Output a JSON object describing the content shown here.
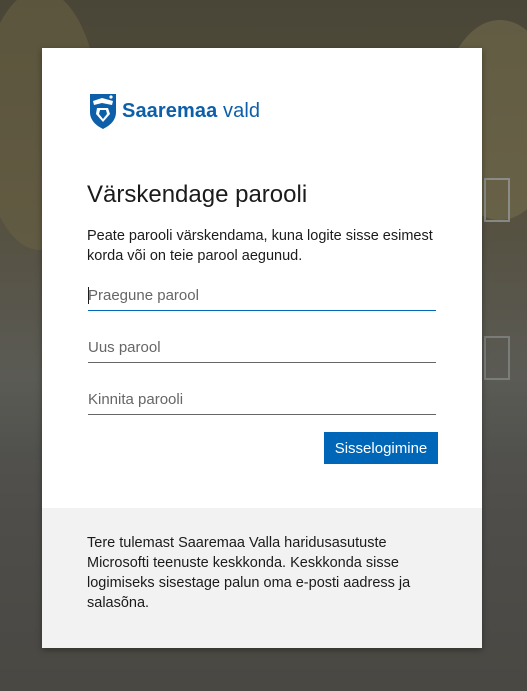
{
  "brand": {
    "name_bold": "Saaremaa",
    "name_light": "vald",
    "logo_icon": "saaremaa-coat-of-arms-icon",
    "color": "#0e5fa9"
  },
  "form": {
    "title": "Värskendage parooli",
    "description": "Peate parooli värskendama, kuna logite sisse esimest korda või on teie parool aegunud.",
    "current_password": {
      "placeholder": "Praegune parool",
      "value": ""
    },
    "new_password": {
      "placeholder": "Uus parool",
      "value": ""
    },
    "confirm_password": {
      "placeholder": "Kinnita parooli",
      "value": ""
    },
    "submit_label": "Sisselogimine",
    "accent_color": "#0067b8"
  },
  "footer": {
    "text": "Tere tulemast Saaremaa Valla haridusasutuste Microsofti teenuste keskkonda. Keskkonda sisse logimiseks sisestage palun oma e-posti aadress ja salasõna."
  }
}
